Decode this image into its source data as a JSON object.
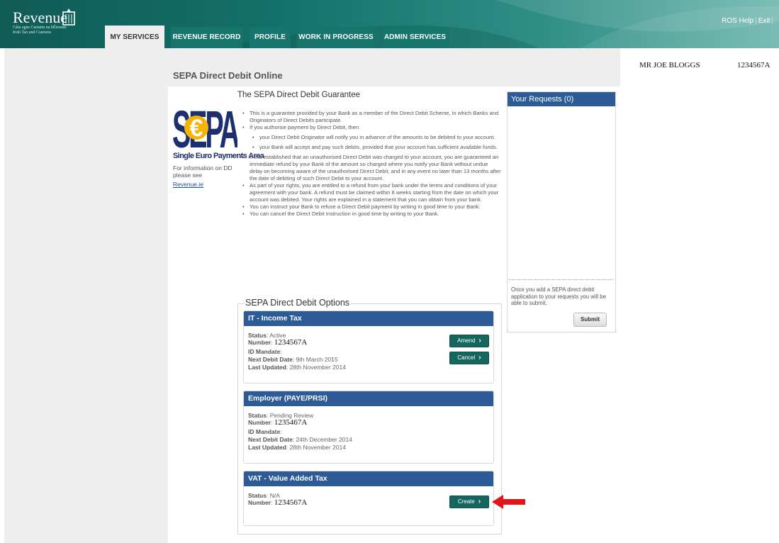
{
  "header": {
    "logo_word": "Revenue",
    "logo_sub1": "Cáin agus Custaim na hÉireann",
    "logo_sub2": "Irish Tax and Customs",
    "tabs": [
      {
        "label": "MY SERVICES",
        "active": true
      },
      {
        "label": "REVENUE RECORD",
        "active": false
      },
      {
        "label": "PROFILE",
        "active": false
      },
      {
        "label": "WORK IN PROGRESS",
        "active": false
      },
      {
        "label": "ADMIN SERVICES",
        "active": false
      }
    ],
    "links": {
      "help": "ROS Help",
      "exit": "Exit"
    }
  },
  "user": {
    "name": "MR JOE BLOGGS",
    "id": "1234567A"
  },
  "page_title": "SEPA Direct Debit Online",
  "sidebar_info": {
    "logo_letters": "SEPA",
    "logo_caption": "Single Euro Payments Area",
    "info_text": "For information on DD please see",
    "info_link": "Revenue.ie"
  },
  "guarantee": {
    "title": "The SEPA Direct Debit Guarantee",
    "b1": "This is a guarantee provided by your Bank as a member of the Direct Debit Scheme, in which Banks and Originators of Direct Debits participate.",
    "b2": "If you authorise payment by Direct Debit, then",
    "s1": "your Direct Debit Originator will notify you in advance of the amounts to be debited to your account.",
    "s2": "your Bank will accept and pay such debits, provided that your account has sufficient available funds.",
    "b3": "If it is established that an unauthorised Direct Debit was charged to your account, you are guaranteed an immediate refund by your Bank of the amount so charged where you notify your Bank without undue delay on becoming aware of the unauthorised Direct Debit, and in any event no later than 13 months after the date of debiting of such Direct Debit to your account.",
    "b4": "As part of your rights, you are entitled to a refund from your bank under the terms and conditions of your agreement with your bank. A refund must be claimed within 8 weeks starting from the date on which your account was debited. Your rights are explained in a statement that you can obtain from your bank.",
    "b5": "You can instruct your Bank to refuse a Direct Debit payment by writing in good time to your Bank.",
    "b6": "You can cancel the Direct Debit Instruction in good time by writing to your Bank."
  },
  "requests": {
    "title": "Your Requests (0)",
    "note": "Once you add a SEPA direct debit application to your requests you will be able to submit.",
    "submit_label": "Submit"
  },
  "options": {
    "legend": "SEPA Direct Debit Options",
    "labels": {
      "status": "Status",
      "number": "Number",
      "mandate": "ID Mandate",
      "next_debit": "Next Debit Date",
      "last_updated": "Last Updated"
    },
    "cards": [
      {
        "title": "IT - Income Tax",
        "status": "Active",
        "number": "1234567A",
        "next_debit": "9th March 2015",
        "last_updated": "28th November 2014",
        "buttons": [
          "Amend",
          "Cancel"
        ]
      },
      {
        "title": "Employer (PAYE/PRSI)",
        "status": "Pending Review",
        "number": "1235467A",
        "next_debit": "24th December 2014",
        "last_updated": "28th November 2014"
      },
      {
        "title": "VAT - Value Added Tax",
        "status": "N/A",
        "number": "1234567A",
        "buttons": [
          "Create"
        ]
      }
    ]
  },
  "colors": {
    "teal": "#14706a",
    "blue_header": "#2c5b97",
    "button": "#14665f",
    "arrow": "#e0161b"
  }
}
